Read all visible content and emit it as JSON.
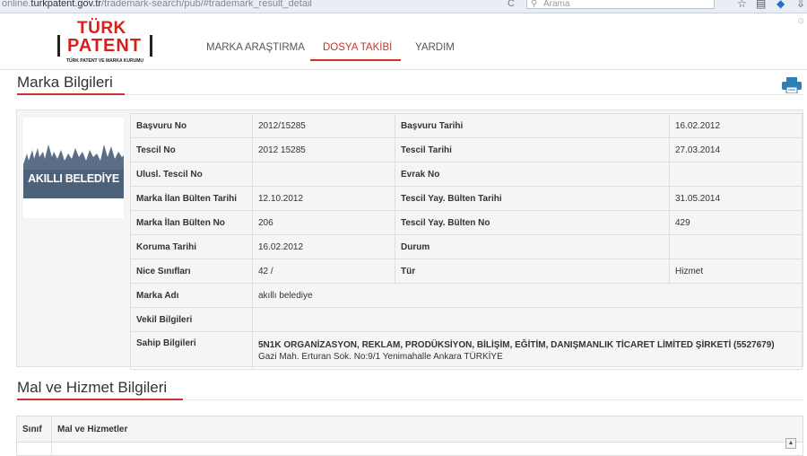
{
  "browser": {
    "url_prefix": "online.",
    "url_host": "turkpatent.gov.tr",
    "url_path": "/trademark-search/pub/#trademark_result_detail",
    "search_placeholder": "Arama"
  },
  "header": {
    "logo_top": "TÜRK",
    "logo_main": "PATENT",
    "logo_sub": "TÜRK PATENT VE MARKA KURUMU",
    "nav": [
      {
        "label": "MARKA ARAŞTIRMA",
        "active": false
      },
      {
        "label": "DOSYA TAKİBİ",
        "active": true
      },
      {
        "label": "YARDIM",
        "active": false
      }
    ]
  },
  "section1": {
    "title": "Marka Bilgileri"
  },
  "brand_image_text": "AKILLI BELEDİYE",
  "info": {
    "basvuru_no_label": "Başvuru No",
    "basvuru_no": "2012/15285",
    "basvuru_tarihi_label": "Başvuru Tarihi",
    "basvuru_tarihi": "16.02.2012",
    "tescil_no_label": "Tescil No",
    "tescil_no": "2012 15285",
    "tescil_tarihi_label": "Tescil Tarihi",
    "tescil_tarihi": "27.03.2014",
    "ulusl_tescil_no_label": "Ulusl. Tescil No",
    "ulusl_tescil_no": "",
    "evrak_no_label": "Evrak No",
    "evrak_no": "",
    "ilan_bulten_tarihi_label": "Marka İlan Bülten Tarihi",
    "ilan_bulten_tarihi": "12.10.2012",
    "tescil_yay_tarihi_label": "Tescil Yay. Bülten Tarihi",
    "tescil_yay_tarihi": "31.05.2014",
    "ilan_bulten_no_label": "Marka İlan Bülten No",
    "ilan_bulten_no": "206",
    "tescil_yay_no_label": "Tescil Yay. Bülten No",
    "tescil_yay_no": "429",
    "koruma_tarihi_label": "Koruma Tarihi",
    "koruma_tarihi": "16.02.2012",
    "durum_label": "Durum",
    "durum": "",
    "nice_label": "Nice Sınıfları",
    "nice": "42 /",
    "tur_label": "Tür",
    "tur": "Hizmet",
    "marka_adi_label": "Marka Adı",
    "marka_adi": "akıllı belediye",
    "vekil_label": "Vekil Bilgileri",
    "vekil": "",
    "sahip_label": "Sahip Bilgileri",
    "sahip_name": "5N1K ORGANİZASYON, REKLAM, PRODÜKSİYON, BİLİŞİM, EĞİTİM, DANIŞMANLIK TİCARET LİMİTED ŞİRKETİ (5527679)",
    "sahip_address": "Gazi Mah. Erturan Sok. No:9/1 Yenimahalle Ankara TÜRKİYE"
  },
  "section2": {
    "title": "Mal ve Hizmet Bilgileri"
  },
  "goods_table": {
    "col_sinif": "Sınıf",
    "col_mal": "Mal ve Hizmetler"
  },
  "colors": {
    "accent": "#d0312d",
    "panel_bg": "#f5f5f5",
    "border": "#dedede"
  }
}
